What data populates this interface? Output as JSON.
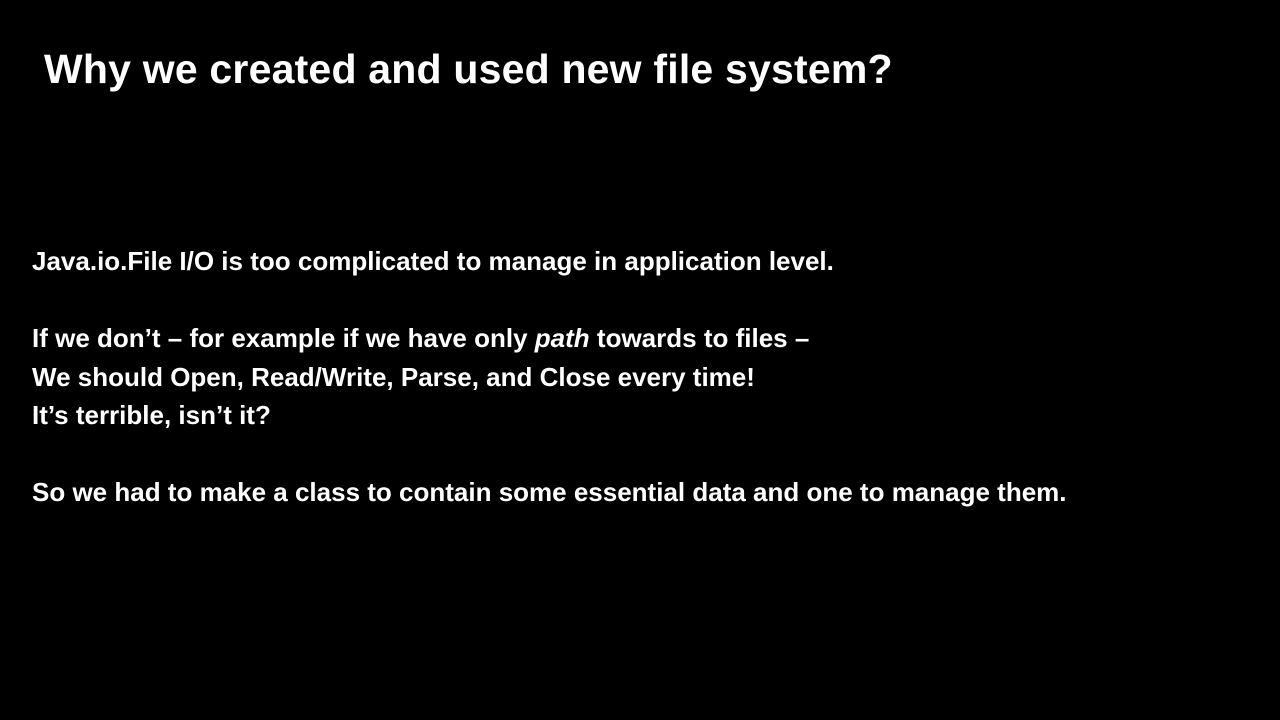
{
  "slide": {
    "title": "Why we created and used new file system?",
    "paragraph1": "Java.io.File I/O is too complicated to manage in application level.",
    "paragraph2": {
      "line1_before": "If we don’t – for example if we have only ",
      "line1_italic": "path",
      "line1_after": " towards to files –",
      "line2": "We should Open, Read/Write, Parse, and Close every time!",
      "line3": "It’s terrible, isn’t it?"
    },
    "paragraph3": "So we had to make a class to contain some essential data and one to manage them."
  },
  "colors": {
    "background": "#000000",
    "text": "#ffffff"
  }
}
